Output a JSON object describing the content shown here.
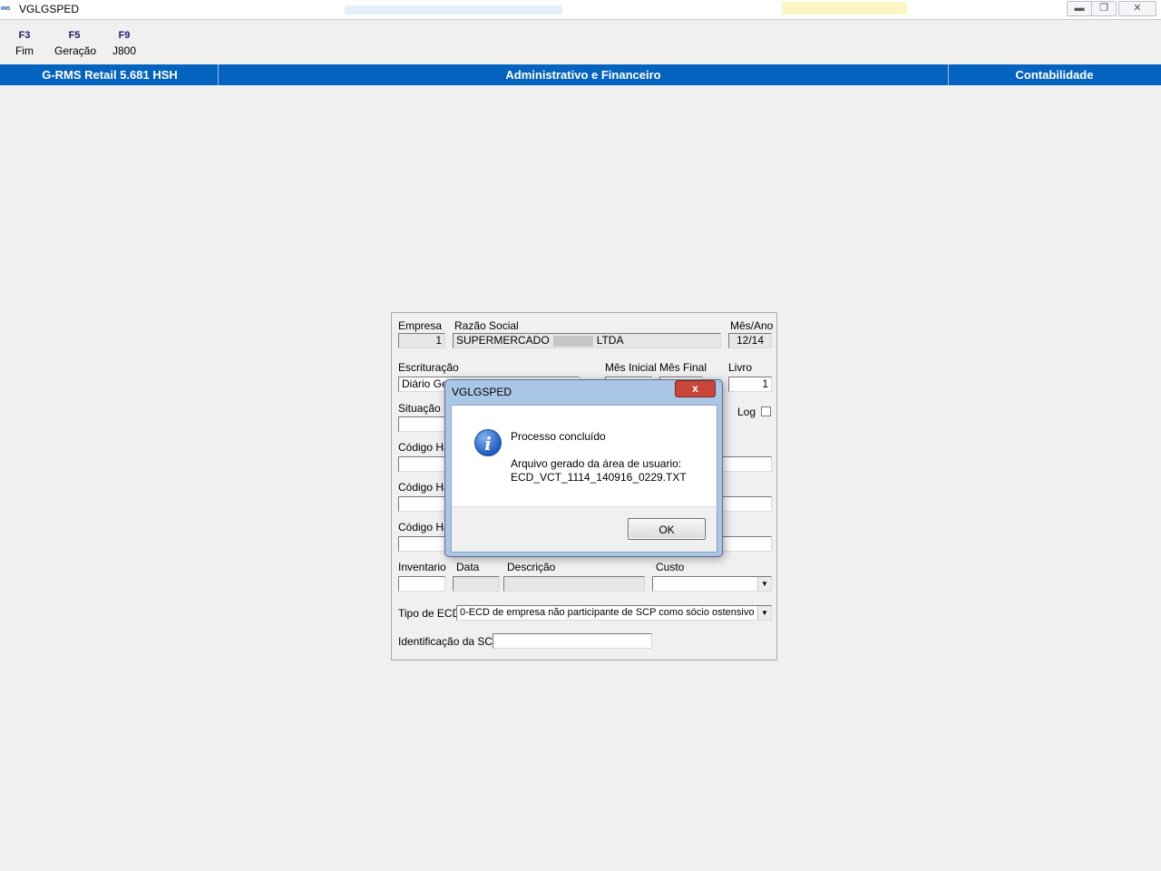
{
  "window": {
    "logo": "RMS",
    "title": "VGLGSPED",
    "controls": {
      "minimize_icon": "minimize-icon",
      "restore_icon": "restore-icon",
      "close_icon": "close-icon"
    }
  },
  "function_keys": [
    {
      "key": "F3",
      "label": "Fim"
    },
    {
      "key": "F5",
      "label": "Geração"
    },
    {
      "key": "F9",
      "label": "J800"
    }
  ],
  "header": {
    "product": "G-RMS Retail 5.681 HSH",
    "area": "Administrativo e Financeiro",
    "module": "Contabilidade",
    "color": "#0563c0"
  },
  "form": {
    "empresa_label": "Empresa",
    "empresa_value": "1",
    "razao_label": "Razão Social",
    "razao_prefix": "SUPERMERCADO",
    "razao_suffix": "LTDA",
    "mesano_label": "Mês/Ano",
    "mesano_value": "12/14",
    "escrituracao_label": "Escrituração",
    "escrituracao_value": "Diário Ger",
    "mes_inicial_label": "Mês Inicial",
    "mes_final_label": "Mês Final",
    "livro_label": "Livro",
    "livro_value": "1",
    "situacao_label": "Situação E",
    "log_label": "Log",
    "codigo_label_1": "Código Ha",
    "codigo_label_2": "Código Ha",
    "codigo_label_3": "Código Ha",
    "inventario_label": "Inventario",
    "data_label": "Data",
    "descricao_label": "Descrição",
    "custo_label": "Custo",
    "tipo_ecd_label": "Tipo de ECD",
    "tipo_ecd_value": "0-ECD de empresa não participante de SCP como sócio ostensivo",
    "scp_label": "Identificação da SCP"
  },
  "dialog": {
    "title": "VGLGSPED",
    "close_glyph": "x",
    "icon": "info-icon",
    "message_title": "Processo concluído",
    "message_line1": "Arquivo gerado da área de usuario:",
    "message_line2": "ECD_VCT_1114_140916_0229.TXT",
    "ok_label": "OK"
  }
}
